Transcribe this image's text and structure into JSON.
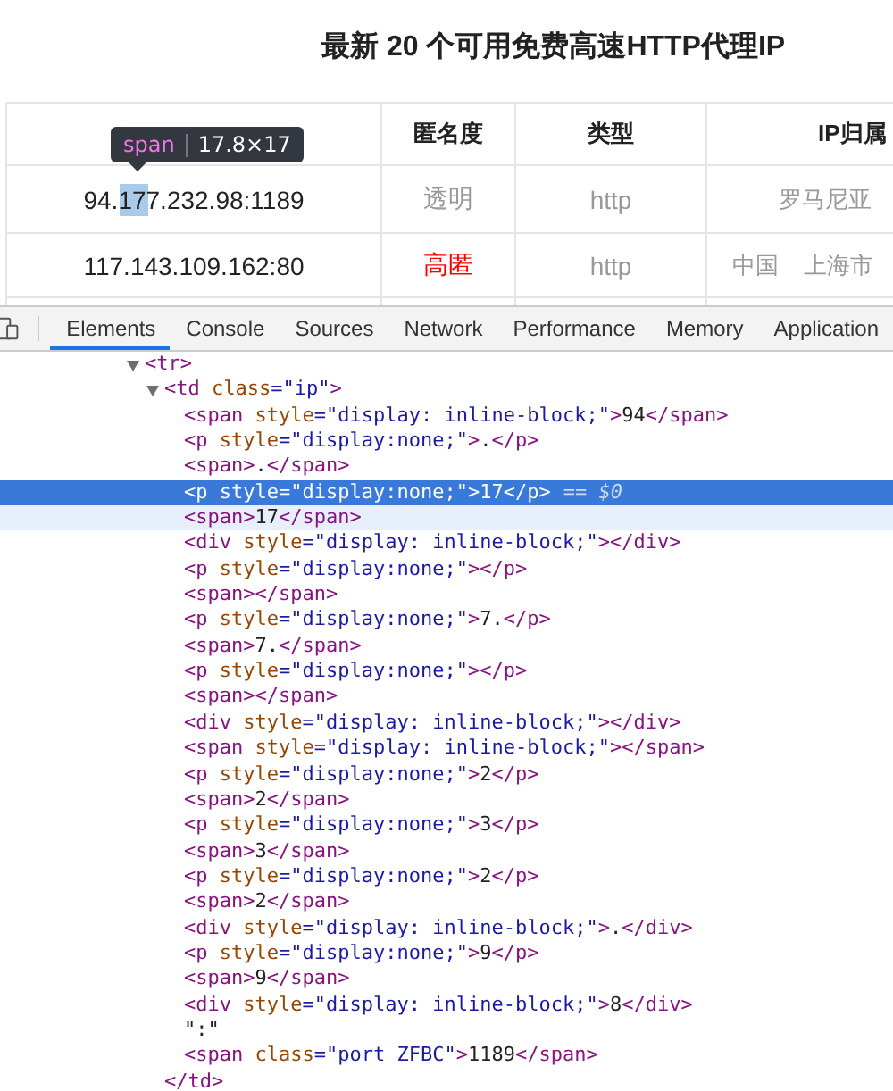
{
  "page": {
    "title": "最新 20 个可用免费高速HTTP代理IP",
    "table": {
      "columns": [
        "匿名度",
        "类型",
        "IP归属"
      ],
      "rows": [
        {
          "ip_port": "94.177.232.98:1189",
          "anonymity": {
            "text": "透明",
            "color": "#999999"
          },
          "type": "http",
          "location": [
            "罗马尼亚"
          ]
        },
        {
          "ip_port": "117.143.109.162:80",
          "anonymity": {
            "text": "高匿",
            "color": "#ff0000"
          },
          "type": "http",
          "location": [
            "中国",
            "上海市"
          ]
        }
      ]
    },
    "inspect_tooltip": {
      "tag": "span",
      "size": "17.8×17"
    }
  },
  "devtools": {
    "tabs": [
      {
        "label": "Elements",
        "selected": true
      },
      {
        "label": "Console",
        "selected": false
      },
      {
        "label": "Sources",
        "selected": false
      },
      {
        "label": "Network",
        "selected": false
      },
      {
        "label": "Performance",
        "selected": false
      },
      {
        "label": "Memory",
        "selected": false
      },
      {
        "label": "Application",
        "selected": false
      }
    ],
    "dom_tree": [
      {
        "text": "<tr>",
        "expanded": true,
        "selected": false,
        "hovered": false,
        "children": [
          {
            "text": "<td class=\"ip\">",
            "expanded": true,
            "selected": false,
            "hovered": false,
            "closing": "</td>",
            "children": [
              {
                "text": "<span style=\"display: inline-block;\">94</span>",
                "selected": false,
                "hovered": false
              },
              {
                "text": "<p style=\"display:none;\">.</p>",
                "selected": false,
                "hovered": false
              },
              {
                "text": "<span>.</span>",
                "selected": false,
                "hovered": false
              },
              {
                "text": "<p style=\"display:none;\">17</p>",
                "selected": true,
                "hovered": false,
                "console_ref": "== $0"
              },
              {
                "text": "<span>17</span>",
                "selected": false,
                "hovered": true
              },
              {
                "text": "<div style=\"display: inline-block;\"></div>",
                "selected": false,
                "hovered": false
              },
              {
                "text": "<p style=\"display:none;\"></p>",
                "selected": false,
                "hovered": false
              },
              {
                "text": "<span></span>",
                "selected": false,
                "hovered": false
              },
              {
                "text": "<p style=\"display:none;\">7.</p>",
                "selected": false,
                "hovered": false
              },
              {
                "text": "<span>7.</span>",
                "selected": false,
                "hovered": false
              },
              {
                "text": "<p style=\"display:none;\"></p>",
                "selected": false,
                "hovered": false
              },
              {
                "text": "<span></span>",
                "selected": false,
                "hovered": false
              },
              {
                "text": "<div style=\"display: inline-block;\"></div>",
                "selected": false,
                "hovered": false
              },
              {
                "text": "<span style=\"display: inline-block;\"></span>",
                "selected": false,
                "hovered": false
              },
              {
                "text": "<p style=\"display:none;\">2</p>",
                "selected": false,
                "hovered": false
              },
              {
                "text": "<span>2</span>",
                "selected": false,
                "hovered": false
              },
              {
                "text": "<p style=\"display:none;\">3</p>",
                "selected": false,
                "hovered": false
              },
              {
                "text": "<span>3</span>",
                "selected": false,
                "hovered": false
              },
              {
                "text": "<p style=\"display:none;\">2</p>",
                "selected": false,
                "hovered": false
              },
              {
                "text": "<span>2</span>",
                "selected": false,
                "hovered": false
              },
              {
                "text": "<div style=\"display: inline-block;\">.</div>",
                "selected": false,
                "hovered": false
              },
              {
                "text": "<p style=\"display:none;\">9</p>",
                "selected": false,
                "hovered": false
              },
              {
                "text": "<span>9</span>",
                "selected": false,
                "hovered": false
              },
              {
                "text": "<div style=\"display: inline-block;\">8</div>",
                "selected": false,
                "hovered": false
              },
              {
                "text": "\":\"",
                "selected": false,
                "hovered": false
              },
              {
                "text": "<span class=\"port ZFBC\">1189</span>",
                "selected": false,
                "hovered": false
              }
            ]
          }
        ]
      }
    ]
  }
}
